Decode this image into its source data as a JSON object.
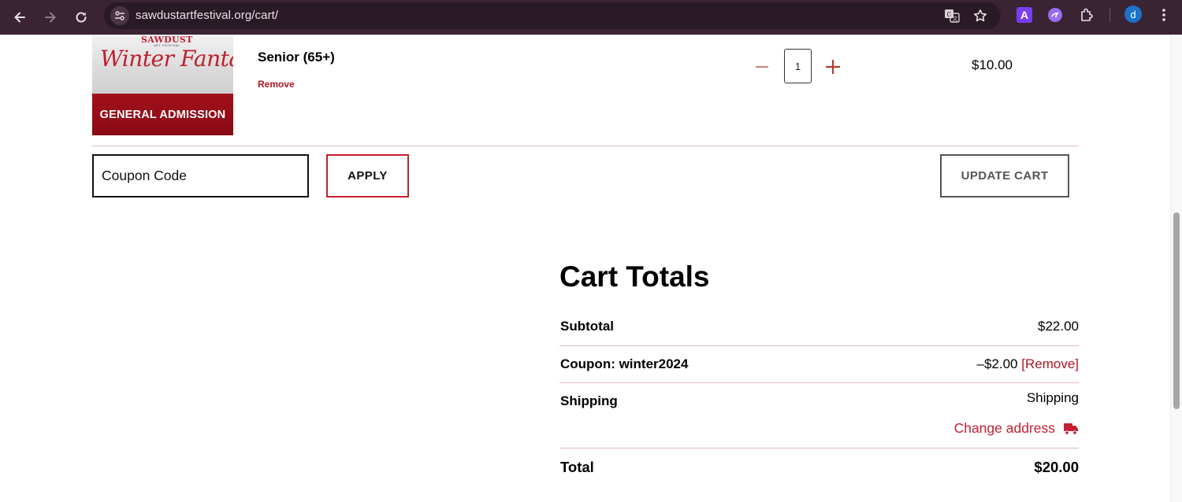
{
  "browser": {
    "url": "sawdustartfestival.org/cart/",
    "profile_initial": "d",
    "extension_letter": "A",
    "icons": [
      "back-arrow-icon",
      "forward-arrow-icon",
      "reload-icon",
      "site-settings-icon",
      "translate-icon",
      "bookmark-star-icon",
      "extension-a-icon",
      "extension-purple-icon",
      "extensions-puzzle-icon",
      "kebab-menu-icon"
    ]
  },
  "cart_item": {
    "thumbnail": {
      "brand": "SAWDUST",
      "brand_sub": "ART FESTIVAL",
      "title": "Winter Fantasy",
      "banner": "GENERAL ADMISSION"
    },
    "name": "Senior (65+)",
    "remove_label": "Remove",
    "quantity": "1",
    "price": "$10.00"
  },
  "coupon": {
    "placeholder": "Coupon Code",
    "apply_label": "APPLY",
    "update_label": "UPDATE CART"
  },
  "totals": {
    "title": "Cart Totals",
    "subtotal_label": "Subtotal",
    "subtotal_value": "$22.00",
    "coupon_label": "Coupon: winter2024",
    "coupon_value": "–$2.00",
    "coupon_remove": "[Remove]",
    "shipping_label": "Shipping",
    "shipping_value": "Shipping",
    "change_address": "Change address",
    "total_label": "Total",
    "total_value": "$20.00"
  },
  "colors": {
    "accent_red": "#c42034",
    "chrome_bg": "#3a2434",
    "divider": "#e2b6bd"
  }
}
